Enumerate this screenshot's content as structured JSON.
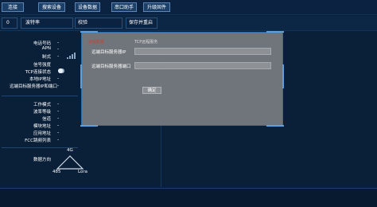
{
  "toolbar": {
    "buttons": [
      "连接",
      "搜索设备",
      "设备数据",
      "串口助手",
      "升级固件"
    ]
  },
  "row2": {
    "index_value": "0",
    "baud_label": "波特率",
    "verify_label": "校验",
    "save_button": "保存并重启"
  },
  "left_panel": {
    "items": [
      {
        "label": "电话号码",
        "value": "-"
      },
      {
        "label": "APN",
        "value": "-"
      },
      {
        "label": "制式",
        "value": "-"
      },
      {
        "label": "信号强度",
        "value": ""
      },
      {
        "label": "TCP连接状态",
        "value": ""
      },
      {
        "label": "本地IP地址",
        "value": "-"
      },
      {
        "label": "远端目标服务器IP和端口",
        "value": "-"
      },
      {
        "label": "工作模式",
        "value": "-"
      },
      {
        "label": "波率等级",
        "value": "-"
      },
      {
        "label": "信道",
        "value": "-"
      },
      {
        "label": "模块地址",
        "value": "-"
      },
      {
        "label": "应用地址",
        "value": "-"
      },
      {
        "label": "FCC跳频列表",
        "value": "-"
      }
    ],
    "direction_label": "数据方向",
    "diagram": {
      "top": "4G",
      "left": "485",
      "right": "Lora"
    }
  },
  "dialog": {
    "title": "远程配置",
    "subtitle": "TCP远程服务",
    "fields": [
      {
        "label": "远端目标服务器IP",
        "value": ""
      },
      {
        "label": "远端目标服务器端口",
        "value": ""
      }
    ],
    "ok_label": "确定"
  },
  "colors": {
    "background": "#0a1f38",
    "button": "#1c3f68",
    "dialog": "#7b7f83",
    "accent": "#5fa0dc",
    "title_red": "#c8402f"
  }
}
